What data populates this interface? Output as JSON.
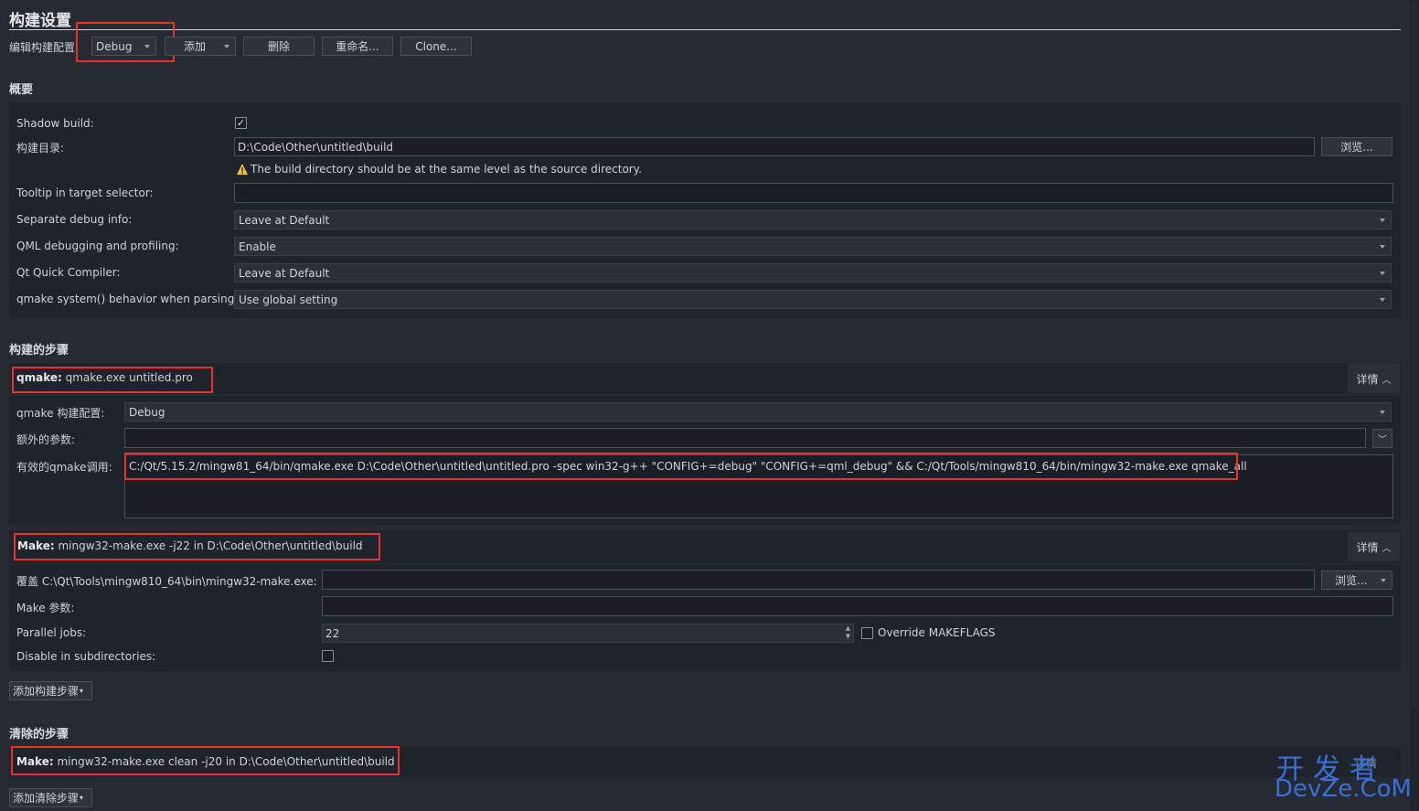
{
  "header": {
    "title": "构建设置",
    "edit_config_label": "编辑构建配置:",
    "config_value": "Debug",
    "add_label": "添加",
    "delete_label": "删除",
    "rename_label": "重命名...",
    "clone_label": "Clone..."
  },
  "overview": {
    "heading": "概要",
    "shadow_build_label": "Shadow build:",
    "build_dir_label": "构建目录:",
    "build_dir_value": "D:\\Code\\Other\\untitled\\build",
    "browse_label": "浏览...",
    "warning_text": "The build directory should be at the same level as the source directory.",
    "tooltip_label": "Tooltip in target selector:",
    "tooltip_value": "",
    "sep_debug_label": "Separate debug info:",
    "sep_debug_value": "Leave at Default",
    "qml_label": "QML debugging and profiling:",
    "qml_value": "Enable",
    "qtquick_label": "Qt Quick Compiler:",
    "qtquick_value": "Leave at Default",
    "qmake_system_label": "qmake system() behavior when parsing:",
    "qmake_system_value": "Use global setting"
  },
  "build_steps": {
    "heading": "构建的步骤",
    "details_label": "详情",
    "qmake_step_title": "qmake:",
    "qmake_step_summary": "qmake.exe untitled.pro",
    "qmake_config_label": "qmake 构建配置:",
    "qmake_config_value": "Debug",
    "extra_args_label": "额外的参数:",
    "extra_args_value": "",
    "effective_label": "有效的qmake调用:",
    "effective_value": "C:/Qt/5.15.2/mingw81_64/bin/qmake.exe D:\\Code\\Other\\untitled\\untitled.pro -spec win32-g++ \"CONFIG+=debug\" \"CONFIG+=qml_debug\" && C:/Qt/Tools/mingw810_64/bin/mingw32-make.exe qmake_all",
    "make_step_title": "Make:",
    "make_step_summary": "mingw32-make.exe -j22 in D:\\Code\\Other\\untitled\\build",
    "override_label": "覆盖 C:\\Qt\\Tools\\mingw810_64\\bin\\mingw32-make.exe:",
    "override_value": "",
    "make_browse_label": "浏览...",
    "make_args_label": "Make 参数:",
    "make_args_value": "",
    "parallel_label": "Parallel jobs:",
    "parallel_value": "22",
    "override_makeflags_label": "Override MAKEFLAGS",
    "disable_subdirs_label": "Disable in subdirectories:",
    "add_step_label": "添加构建步骤"
  },
  "clean_steps": {
    "heading": "清除的步骤",
    "make_step_title": "Make:",
    "make_step_summary": "mingw32-make.exe clean -j20 in D:\\Code\\Other\\untitled\\build",
    "details_label": "详情",
    "add_step_label": "添加清除步骤"
  },
  "watermark": {
    "line1": "开发者",
    "line2": "DevZe.CoM"
  },
  "colors": {
    "background": "#262a33",
    "panel": "#1f232b",
    "highlight_box": "#e8322c",
    "watermark": "#3b6fd8"
  }
}
